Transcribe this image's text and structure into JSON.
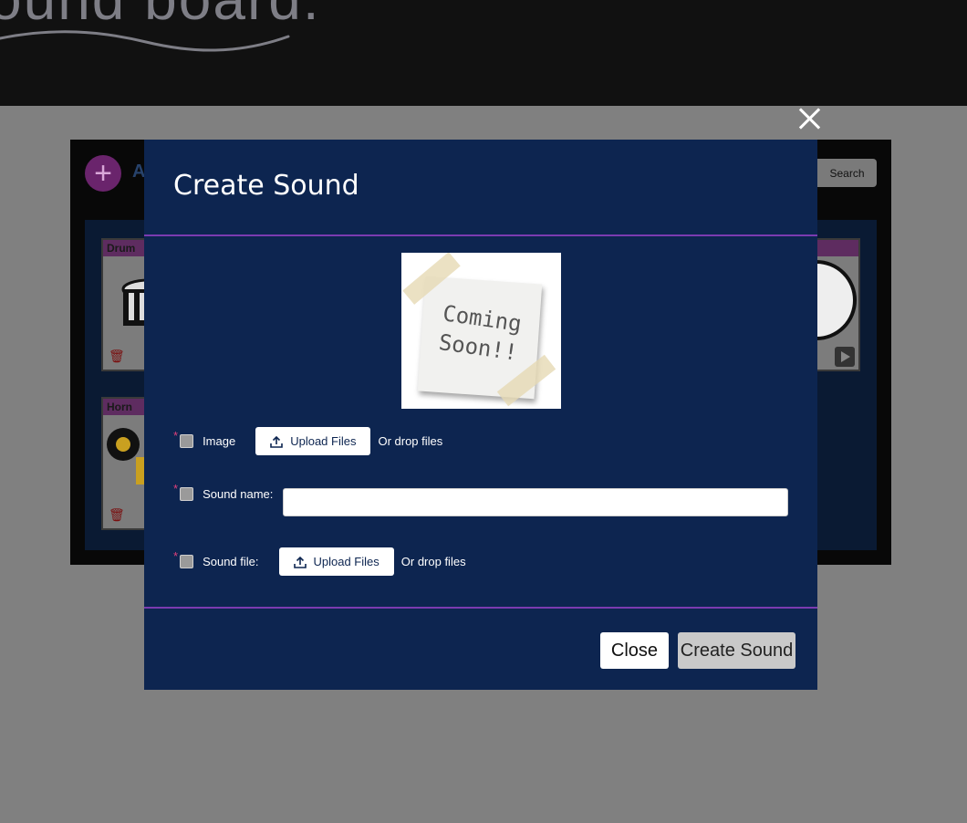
{
  "header": {
    "logo_text": "ound board."
  },
  "board": {
    "add_label": "A",
    "search_label": "Search",
    "cards": [
      {
        "title": "Drum r"
      },
      {
        "title": "Horn"
      }
    ]
  },
  "modal": {
    "title": "Create Sound",
    "preview_text_line1": "Coming",
    "preview_text_line2": "Soon!!",
    "required_mark": "*",
    "image_label": "Image",
    "upload_label": "Upload Files",
    "drop_label": "Or drop files",
    "sound_name_label": "Sound name:",
    "sound_name_value": "",
    "sound_file_label": "Sound file:",
    "close_button": "Close",
    "create_button": "Create Sound"
  },
  "colors": {
    "modal_bg": "#0d2550",
    "divider": "#7b3bb0",
    "overlay": "#808080",
    "required": "#e0407a"
  },
  "icons": {
    "close": "close-icon",
    "upload": "upload-icon",
    "add": "plus-icon",
    "trash": "trash-icon",
    "play": "play-icon"
  }
}
